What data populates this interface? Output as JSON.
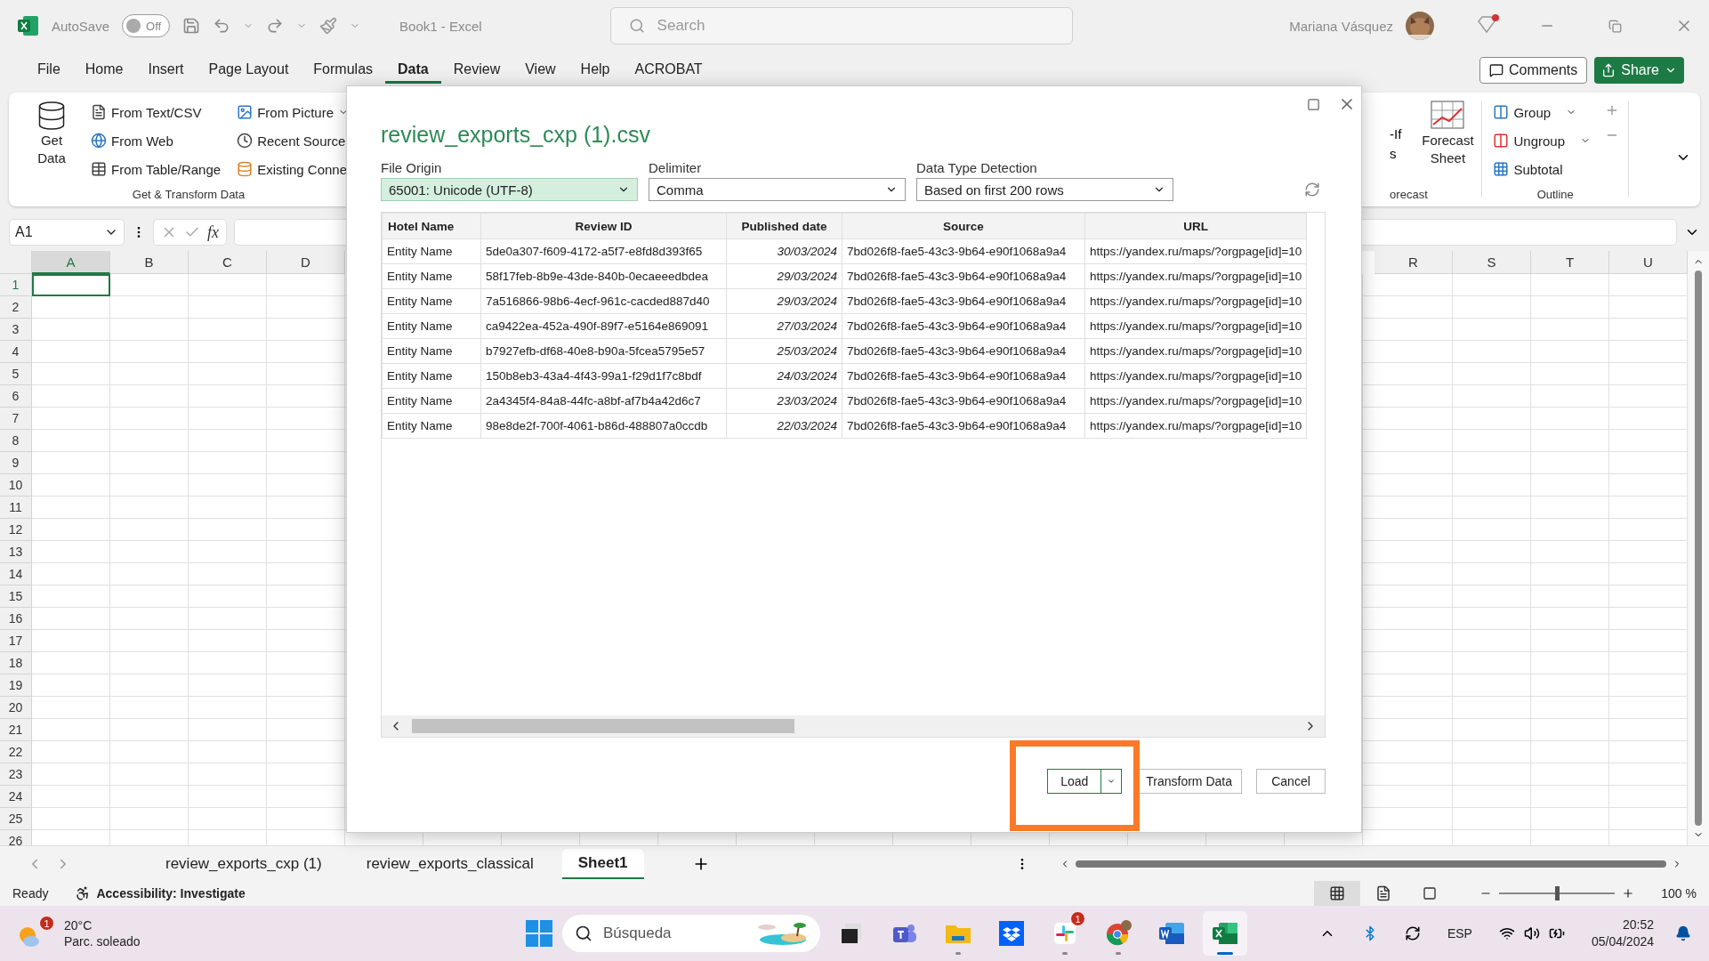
{
  "title_bar": {
    "autosave_label": "AutoSave",
    "autosave_toggle": {
      "label": "Off",
      "on": false
    },
    "document_title": "Book1  -  Excel",
    "search_placeholder": "Search",
    "user_name": "Mariana Vásquez"
  },
  "ribbon_tabs": [
    {
      "label": "File",
      "selected": false
    },
    {
      "label": "Home",
      "selected": false
    },
    {
      "label": "Insert",
      "selected": false
    },
    {
      "label": "Page Layout",
      "selected": false
    },
    {
      "label": "Formulas",
      "selected": false
    },
    {
      "label": "Data",
      "selected": true
    },
    {
      "label": "Review",
      "selected": false
    },
    {
      "label": "View",
      "selected": false
    },
    {
      "label": "Help",
      "selected": false
    },
    {
      "label": "ACROBAT",
      "selected": false
    }
  ],
  "ribbon": {
    "get_data": "Get Data",
    "commands": [
      {
        "label": "From Text/CSV",
        "kind": "text-file",
        "menu": false
      },
      {
        "label": "From Web",
        "kind": "web",
        "menu": false
      },
      {
        "label": "From Table/Range",
        "kind": "table",
        "menu": false
      },
      {
        "label": "From Picture",
        "kind": "picture",
        "menu": true
      },
      {
        "label": "Recent Source",
        "kind": "clock",
        "menu": false
      },
      {
        "label": "Existing Conne",
        "kind": "database",
        "menu": false
      }
    ],
    "get_transform_group": "Get & Transform Data",
    "whatif_partial": [
      "-If",
      "s"
    ],
    "forecast_sheet": "Forecast Sheet",
    "forecast_group": "orecast",
    "outline_commands": [
      {
        "label": "Group",
        "kind": "group",
        "menu": true
      },
      {
        "label": "Ungroup",
        "kind": "ungroup",
        "menu": true
      },
      {
        "label": "Subtotal",
        "kind": "subtotal",
        "menu": false
      }
    ],
    "outline_group": "Outline",
    "comments": "Comments",
    "share": "Share"
  },
  "formula_bar": {
    "name_box": "A1",
    "function_label": "fx"
  },
  "grid": {
    "columns_left": [
      {
        "label": "A",
        "selected": true
      },
      {
        "label": "B",
        "selected": false
      },
      {
        "label": "C",
        "selected": false
      },
      {
        "label": "D",
        "selected": false
      }
    ],
    "columns_right": [
      {
        "label": "R",
        "selected": false
      },
      {
        "label": "S",
        "selected": false
      },
      {
        "label": "T",
        "selected": false
      },
      {
        "label": "U",
        "selected": false
      }
    ],
    "rows": [
      {
        "label": "1",
        "selected": true
      },
      {
        "label": "2",
        "selected": false
      },
      {
        "label": "3",
        "selected": false
      },
      {
        "label": "4",
        "selected": false
      },
      {
        "label": "5",
        "selected": false
      },
      {
        "label": "6",
        "selected": false
      },
      {
        "label": "7",
        "selected": false
      },
      {
        "label": "8",
        "selected": false
      },
      {
        "label": "9",
        "selected": false
      },
      {
        "label": "10",
        "selected": false
      },
      {
        "label": "11",
        "selected": false
      },
      {
        "label": "12",
        "selected": false
      },
      {
        "label": "13",
        "selected": false
      },
      {
        "label": "14",
        "selected": false
      },
      {
        "label": "15",
        "selected": false
      },
      {
        "label": "16",
        "selected": false
      },
      {
        "label": "17",
        "selected": false
      },
      {
        "label": "18",
        "selected": false
      },
      {
        "label": "19",
        "selected": false
      },
      {
        "label": "20",
        "selected": false
      },
      {
        "label": "21",
        "selected": false
      },
      {
        "label": "22",
        "selected": false
      },
      {
        "label": "23",
        "selected": false
      },
      {
        "label": "24",
        "selected": false
      },
      {
        "label": "25",
        "selected": false
      },
      {
        "label": "26",
        "selected": false
      }
    ]
  },
  "dialog": {
    "title": "review_exports_cxp (1).csv",
    "fields": [
      {
        "label": "File Origin",
        "value": "65001: Unicode (UTF-8)",
        "highlighted": true
      },
      {
        "label": "Delimiter",
        "value": "Comma",
        "highlighted": false
      },
      {
        "label": "Data Type Detection",
        "value": "Based on first 200 rows",
        "highlighted": false
      }
    ],
    "table": {
      "columns": [
        "Hotel Name",
        "Review ID",
        "Published date",
        "Source",
        "URL"
      ],
      "rows": [
        [
          "Entity Name",
          "5de0a307-f609-4172-a5f7-e8fd8d393f65",
          "30/03/2024",
          "7bd026f8-fae5-43c3-9b64-e90f1068a9a4",
          "https://yandex.ru/maps/?orgpage[id]=10"
        ],
        [
          "Entity Name",
          "58f17feb-8b9e-43de-840b-0ecaeeedbdea",
          "29/03/2024",
          "7bd026f8-fae5-43c3-9b64-e90f1068a9a4",
          "https://yandex.ru/maps/?orgpage[id]=10"
        ],
        [
          "Entity Name",
          "7a516866-98b6-4ecf-961c-cacded887d40",
          "29/03/2024",
          "7bd026f8-fae5-43c3-9b64-e90f1068a9a4",
          "https://yandex.ru/maps/?orgpage[id]=10"
        ],
        [
          "Entity Name",
          "ca9422ea-452a-490f-89f7-e5164e869091",
          "27/03/2024",
          "7bd026f8-fae5-43c3-9b64-e90f1068a9a4",
          "https://yandex.ru/maps/?orgpage[id]=10"
        ],
        [
          "Entity Name",
          "b7927efb-df68-40e8-b90a-5fcea5795e57",
          "25/03/2024",
          "7bd026f8-fae5-43c3-9b64-e90f1068a9a4",
          "https://yandex.ru/maps/?orgpage[id]=10"
        ],
        [
          "Entity Name",
          "150b8eb3-43a4-4f43-99a1-f29d1f7c8bdf",
          "24/03/2024",
          "7bd026f8-fae5-43c3-9b64-e90f1068a9a4",
          "https://yandex.ru/maps/?orgpage[id]=10"
        ],
        [
          "Entity Name",
          "2a4345f4-84a8-44fc-a8bf-af7b4a42d6c7",
          "23/03/2024",
          "7bd026f8-fae5-43c3-9b64-e90f1068a9a4",
          "https://yandex.ru/maps/?orgpage[id]=10"
        ],
        [
          "Entity Name",
          "98e8de2f-700f-4061-b86d-488807a0ccdb",
          "22/03/2024",
          "7bd026f8-fae5-43c3-9b64-e90f1068a9a4",
          "https://yandex.ru/maps/?orgpage[id]=10"
        ]
      ]
    },
    "buttons": {
      "load": "Load",
      "transform": "Transform Data",
      "cancel": "Cancel"
    },
    "highlight_load": true
  },
  "sheet_tabs": [
    {
      "label": "review_exports_cxp (1)",
      "selected": false
    },
    {
      "label": "review_exports_classical",
      "selected": false
    },
    {
      "label": "Sheet1",
      "selected": true
    }
  ],
  "status_bar": {
    "ready": "Ready",
    "accessibility": "Accessibility: Investigate",
    "views": [
      {
        "kind": "normal",
        "selected": true
      },
      {
        "kind": "page-layout",
        "selected": false
      },
      {
        "kind": "page-break",
        "selected": false
      }
    ],
    "zoom": {
      "level": 0.5,
      "label": "100 %"
    }
  },
  "taskbar": {
    "weather": {
      "badge": "1",
      "temperature": "20°C",
      "condition": "Parc. soleado"
    },
    "search_placeholder": "Búsqueda",
    "apps": [
      {
        "kind": "task-view",
        "selected": false,
        "running": false
      },
      {
        "kind": "teams",
        "selected": false,
        "running": false
      },
      {
        "kind": "explorer",
        "selected": false,
        "running": true
      },
      {
        "kind": "dropbox",
        "selected": false,
        "running": false
      },
      {
        "kind": "slack",
        "selected": false,
        "running": true,
        "badge": "1"
      },
      {
        "kind": "chrome",
        "selected": false,
        "running": true
      },
      {
        "kind": "word",
        "selected": false,
        "running": false
      },
      {
        "kind": "excel",
        "selected": true,
        "running": true
      }
    ],
    "tray": {
      "language": "ESP",
      "time": "20:52",
      "date": "05/04/2024"
    }
  }
}
